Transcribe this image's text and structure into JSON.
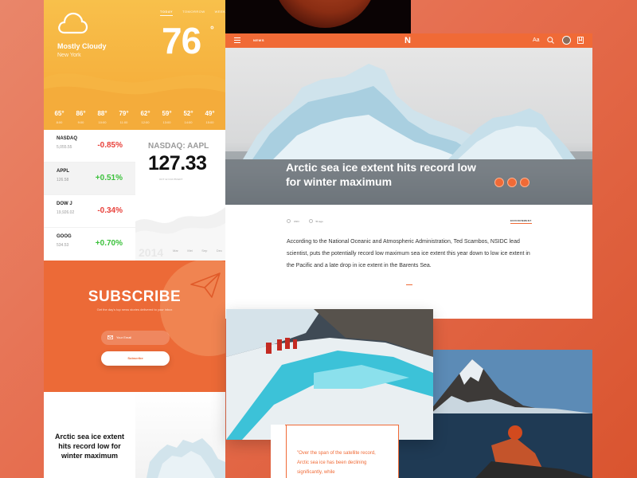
{
  "weather": {
    "condition": "Mostly Cloudy",
    "city": "New York",
    "tabs": [
      "TODAY",
      "TOMORROW",
      "WEEK"
    ],
    "active_tab": "TODAY",
    "temperature": "76",
    "degree_symbol": "°",
    "icon": "cloud-icon",
    "forecast": [
      {
        "temp": "65°",
        "hour": "8:00"
      },
      {
        "temp": "86°",
        "hour": "9:00"
      },
      {
        "temp": "88°",
        "hour": "10:00"
      },
      {
        "temp": "79°",
        "hour": "11:00"
      },
      {
        "temp": "62°",
        "hour": "12:00"
      },
      {
        "temp": "59°",
        "hour": "13:00"
      },
      {
        "temp": "52°",
        "hour": "14:00"
      },
      {
        "temp": "49°",
        "hour": "15:00"
      }
    ]
  },
  "stocks": {
    "items": [
      {
        "name": "NASDAQ",
        "value": "5,055.55",
        "change": "-0.85%",
        "direction": "down"
      },
      {
        "name": "APPL",
        "value": "126.58",
        "change": "+0.51%",
        "direction": "up"
      },
      {
        "name": "DOW J",
        "value": "19,926.02",
        "change": "-0.34%",
        "direction": "down"
      },
      {
        "name": "GOOG",
        "value": "534.53",
        "change": "+0.70%",
        "direction": "up"
      }
    ],
    "selected": "APPL",
    "colors": {
      "down": "#e8413b",
      "up": "#3cc13c"
    }
  },
  "stock_detail": {
    "title": "NASDAQ: AAPL",
    "price": "127.33",
    "timestamp": "OCT 12 3:16 PM EDT",
    "year": "2014",
    "months": [
      "Mar",
      "Mei",
      "Sep",
      "Dec"
    ]
  },
  "subscribe": {
    "title": "SUBSCRIBE",
    "description": "Get the day's top news stories delivered to your inbox",
    "email_placeholder": "Your Email",
    "button_label": "Subscribe",
    "icon": "paper-plane-icon"
  },
  "side_article": {
    "title": "Arctic sea ice extent hits record low for winter maximum"
  },
  "article": {
    "nav_label": "NEWS",
    "logo": "N",
    "font_label": "Aa",
    "headline": "Arctic sea ice extent hits record low for winter maximum",
    "source": "CNN",
    "time_ago": "5h ago",
    "category": "ENVIRONMENT",
    "body": "According to the National Oceanic and Atmospheric Administration, Ted Scambos, NSIDC lead scientist, puts the potentially record low maximum sea ice extent this year down to low ice extent in the Pacific and a late drop in ice extent in the Barents Sea.",
    "accent_color": "#f06a36"
  },
  "quote": {
    "text": "\"Over the span of the satellite record, Arctic sea ice has been declining significantly, while"
  }
}
